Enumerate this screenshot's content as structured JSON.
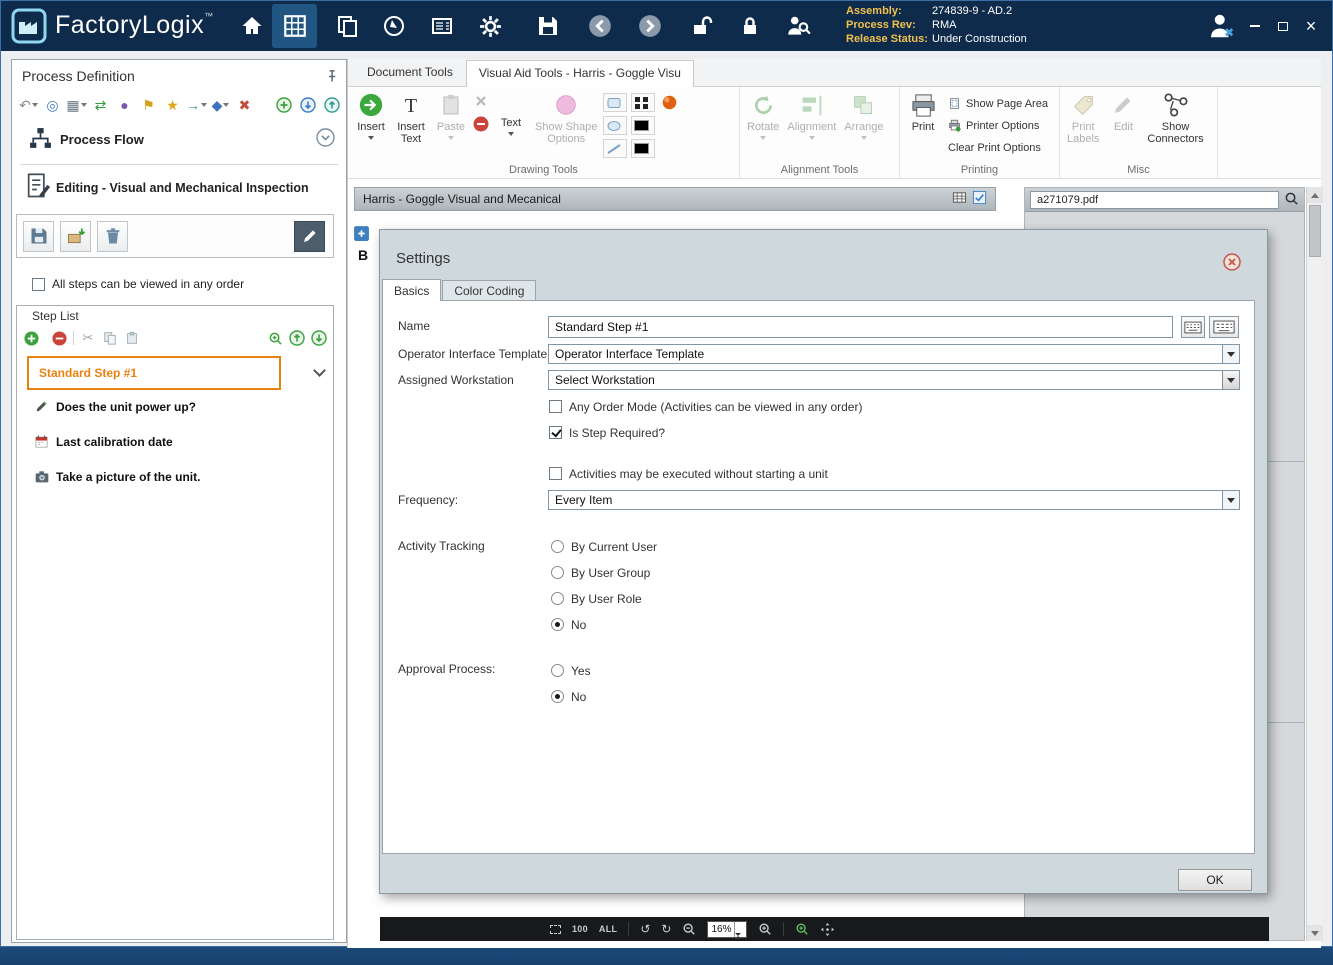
{
  "titlebar": {
    "app_name": "FactoryLogix",
    "trademark": "™",
    "assembly_label": "Assembly:",
    "assembly_value": "274839-9 - AD.2",
    "process_rev_label": "Process Rev:",
    "process_rev_value": "RMA",
    "release_status_label": "Release Status:",
    "release_status_value": "Under Construction"
  },
  "left_panel": {
    "title": "Process Definition",
    "process_flow_label": "Process Flow",
    "editing_label": "Editing - Visual and Mechanical Inspection",
    "order_checkbox_label": "All steps can be viewed in any order",
    "step_list_title": "Step List",
    "steps": [
      {
        "label": "Standard Step #1"
      },
      {
        "label": "Does the unit power up?"
      },
      {
        "label": "Last calibration date"
      },
      {
        "label": "Take a picture of the unit."
      }
    ]
  },
  "ribbon": {
    "tab_document_tools": "Document Tools",
    "tab_visual_aid": "Visual Aid Tools - Harris - Goggle Visu",
    "insert_label": "Insert",
    "insert_text_line1": "Insert",
    "insert_text_line2": "Text",
    "paste_label": "Paste",
    "text_label": "Text",
    "show_shape_line1": "Show Shape",
    "show_shape_line2": "Options",
    "rotate_label": "Rotate",
    "alignment_label": "Alignment",
    "arrange_label": "Arrange",
    "print_label": "Print",
    "show_page_area_label": "Show Page Area",
    "printer_options_label": "Printer Options",
    "clear_print_options_label": "Clear Print Options",
    "print_labels_line1": "Print",
    "print_labels_line2": "Labels",
    "edit_label": "Edit",
    "show_connectors_line1": "Show",
    "show_connectors_line2": "Connectors",
    "group_drawing": "Drawing Tools",
    "group_alignment": "Alignment Tools",
    "group_printing": "Printing",
    "group_misc": "Misc"
  },
  "document": {
    "header_title": "Harris - Goggle Visual and Mecanical",
    "pdf_name": "a271079.pdf",
    "side_label": "B",
    "zoom_fit_100": "100",
    "zoom_fit_all": "ALL",
    "zoom_value": "16%"
  },
  "dialog": {
    "title": "Settings",
    "tab_basics": "Basics",
    "tab_color_coding": "Color Coding",
    "name_label": "Name",
    "name_value": "Standard Step #1",
    "oit_label": "Operator Interface Template",
    "oit_value": "Operator Interface Template",
    "workstation_label": "Assigned Workstation",
    "workstation_value": "Select Workstation",
    "any_order_label": "Any Order Mode (Activities can be viewed in any order)",
    "step_required_label": "Is Step Required?",
    "activities_label": "Activities may be executed without starting a unit",
    "frequency_label": "Frequency:",
    "frequency_value": "Every Item",
    "activity_tracking_label": "Activity Tracking",
    "radio_by_current_user": "By Current User",
    "radio_by_user_group": "By User Group",
    "radio_by_user_role": "By User Role",
    "radio_tracking_no": "No",
    "approval_label": "Approval Process:",
    "radio_approval_yes": "Yes",
    "radio_approval_no": "No",
    "ok_label": "OK"
  },
  "colors": {
    "titlebar_bg": "#0e2b4c",
    "accent_orange": "#e8820e",
    "label_yellow": "#f2c14b",
    "dialog_bg": "#cfd8dd"
  }
}
